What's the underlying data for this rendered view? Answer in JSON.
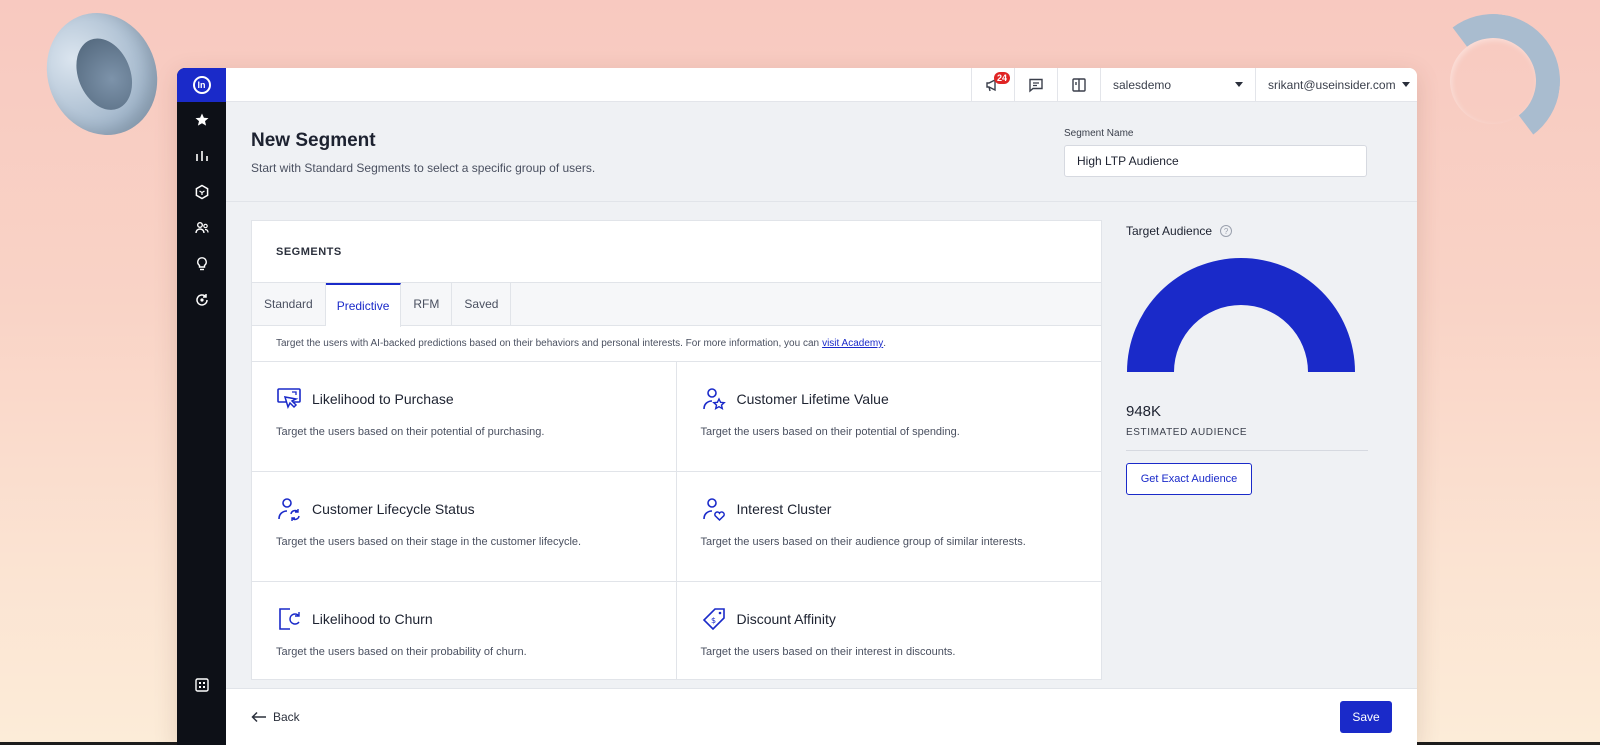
{
  "topbar": {
    "notification_count": "24",
    "account": "salesdemo",
    "user": "srikant@useinsider.com"
  },
  "header": {
    "title": "New Segment",
    "subtitle": "Start with Standard Segments to select a specific group of users.",
    "segment_name_label": "Segment Name",
    "segment_name_value": "High LTP Audience"
  },
  "segments": {
    "title": "SEGMENTS",
    "tabs": [
      {
        "label": "Standard",
        "active": false
      },
      {
        "label": "Predictive",
        "active": true
      },
      {
        "label": "RFM",
        "active": false
      },
      {
        "label": "Saved",
        "active": false
      }
    ],
    "info_text": "Target the users with AI-backed predictions based on their behaviors and personal interests. For more information, you can",
    "info_link": "visit Academy",
    "info_end": ".",
    "cards": [
      {
        "title": "Likelihood to Purchase",
        "description": "Target the users based on their potential of purchasing.",
        "icon": "purchase-cursor-icon"
      },
      {
        "title": "Customer Lifetime Value",
        "description": "Target the users based on their potential of spending.",
        "icon": "user-star-icon"
      },
      {
        "title": "Customer Lifecycle Status",
        "description": "Target the users based on their stage in the customer lifecycle.",
        "icon": "user-refresh-icon"
      },
      {
        "title": "Interest Cluster",
        "description": "Target the users based on their audience group of similar interests.",
        "icon": "user-heart-icon"
      },
      {
        "title": "Likelihood to Churn",
        "description": "Target the users based on their probability of churn.",
        "icon": "exit-door-icon"
      },
      {
        "title": "Discount Affinity",
        "description": "Target the users based on their interest in discounts.",
        "icon": "price-tag-icon"
      }
    ]
  },
  "audience": {
    "title": "Target Audience",
    "help_glyph": "?",
    "estimated_value": "948K",
    "estimated_label": "ESTIMATED AUDIENCE",
    "exact_button": "Get Exact Audience",
    "gauge_fill": 1.0,
    "gauge_color": "#1a2ac9"
  },
  "footer": {
    "back_label": "Back",
    "save_label": "Save"
  },
  "colors": {
    "accent": "#1a2ac9",
    "sidebar": "#0d1017",
    "badge": "#e02424"
  }
}
